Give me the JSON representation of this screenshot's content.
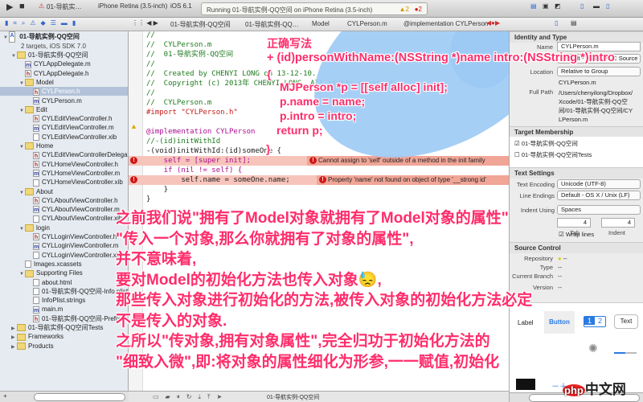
{
  "toolbar": {
    "scheme": "01-导航实…",
    "device": "iPhone Retina (3.5-inch)",
    "os": "iOS 6.1",
    "status": "Running 01-导航实例-QQ空间 on iPhone Retina (3.5-inch)",
    "warnings": "2",
    "errors": "2"
  },
  "jumpbar": [
    "01-导航实例-QQ空间",
    "01-导航实例-QQ…",
    "Model",
    "CYLPerson.m",
    "@implementation CYLPerson"
  ],
  "sidebar": {
    "project": "01-导航实例-QQ空间",
    "project_sub": "2 targets, iOS SDK 7.0",
    "items": [
      {
        "label": "01-导航实例-QQ空间",
        "type": "f",
        "lvl": 1
      },
      {
        "label": "CYLAppDelegate.m",
        "type": "m",
        "lvl": 2
      },
      {
        "label": "CYLAppDelegate.h",
        "type": "h",
        "lvl": 2
      },
      {
        "label": "Model",
        "type": "f",
        "lvl": 2
      },
      {
        "label": "CYLPerson.h",
        "type": "h",
        "lvl": 3,
        "sel": true
      },
      {
        "label": "CYLPerson.m",
        "type": "m",
        "lvl": 3
      },
      {
        "label": "Edit",
        "type": "f",
        "lvl": 2
      },
      {
        "label": "CYLEditViewController.h",
        "type": "h",
        "lvl": 3
      },
      {
        "label": "CYLEditViewController.m",
        "type": "m",
        "lvl": 3
      },
      {
        "label": "CYLEditViewController.xib",
        "type": "x",
        "lvl": 3
      },
      {
        "label": "Home",
        "type": "f",
        "lvl": 2
      },
      {
        "label": "CYLEditViewControllerDelegate.h",
        "type": "h",
        "lvl": 3
      },
      {
        "label": "CYLHomeViewController.h",
        "type": "h",
        "lvl": 3
      },
      {
        "label": "CYLHomeViewController.m",
        "type": "m",
        "lvl": 3
      },
      {
        "label": "CYLHomeViewController.xib",
        "type": "x",
        "lvl": 3
      },
      {
        "label": "About",
        "type": "f",
        "lvl": 2
      },
      {
        "label": "CYLAboutViewController.h",
        "type": "h",
        "lvl": 3
      },
      {
        "label": "CYLAboutViewController.m",
        "type": "m",
        "lvl": 3
      },
      {
        "label": "CYLAboutViewController.xib",
        "type": "x",
        "lvl": 3
      },
      {
        "label": "login",
        "type": "f",
        "lvl": 2
      },
      {
        "label": "CYLLoginViewController.h",
        "type": "h",
        "lvl": 3
      },
      {
        "label": "CYLLoginViewController.m",
        "type": "m",
        "lvl": 3
      },
      {
        "label": "CYLLoginViewController.xib",
        "type": "x",
        "lvl": 3
      },
      {
        "label": "Images.xcassets",
        "type": "a",
        "lvl": 2
      },
      {
        "label": "Supporting Files",
        "type": "f",
        "lvl": 2
      },
      {
        "label": "about.html",
        "type": "x",
        "lvl": 3
      },
      {
        "label": "01-导航实例-QQ空间-Info.plist",
        "type": "x",
        "lvl": 3
      },
      {
        "label": "InfoPlist.strings",
        "type": "x",
        "lvl": 3
      },
      {
        "label": "main.m",
        "type": "m",
        "lvl": 3
      },
      {
        "label": "01-导航实例-QQ空间-Prefix.pch",
        "type": "h",
        "lvl": 3
      },
      {
        "label": "01-导航实例-QQ空间Tests",
        "type": "f",
        "lvl": 1
      },
      {
        "label": "Frameworks",
        "type": "f",
        "lvl": 1
      },
      {
        "label": "Products",
        "type": "f",
        "lvl": 1
      }
    ]
  },
  "code": [
    {
      "t": "//",
      "c": "cm"
    },
    {
      "t": "//  CYLPerson.m",
      "c": "cm"
    },
    {
      "t": "//  01-导航实例-QQ空间",
      "c": "cm"
    },
    {
      "t": "//",
      "c": "cm"
    },
    {
      "t": "//  Created by CHENYI LONG on 13-12-10.",
      "c": "cm"
    },
    {
      "t": "//  Copyright (c) 2013年 CHENYI LONG. All rights reserved.",
      "c": "cm"
    },
    {
      "t": "//",
      "c": "cm"
    },
    {
      "t": "//  CYLPerson.m",
      "c": "cm"
    },
    {
      "t": "#import \"CYLPerson.h\"",
      "c": "st"
    },
    {
      "t": "",
      "c": "tx"
    },
    {
      "t": "@implementation CYLPerson",
      "c": "kw"
    },
    {
      "t": "//-(id)initWithId",
      "c": "cm"
    },
    {
      "t": "-(void)initWithId:(id)someOne {",
      "c": "tx"
    },
    {
      "t": "    self = [super init];",
      "c": "kw"
    },
    {
      "t": "    if (nil != self) {",
      "c": "kw"
    },
    {
      "t": "        self.name = someOne.name;",
      "c": "tx"
    },
    {
      "t": "    }",
      "c": "tx"
    },
    {
      "t": "}",
      "c": "tx"
    }
  ],
  "errors": [
    "Cannot assign to 'self' outside of a method in the init family",
    "Property 'name' not found on object of type '__strong id'"
  ],
  "annotation": {
    "title": "正确写法",
    "sig": "+ (id)personWithName:(NSString *)name intro:(NSString *)intro",
    "open": "{",
    "l1": "MJPerson *p = [[self alloc] init];",
    "l2": "p.name = name;",
    "l3": "p.intro = intro;",
    "l4": "return p;",
    "close": "}"
  },
  "overlay": [
    "之前我们说\"拥有了Model对象就拥有了Model对象的属性\"",
    "\"传入一个对象,那么你就拥有了对象的属性\",",
    "并不意味着,",
    "要对Model的初始化方法也传入对象😓,",
    "那些传入对象进行初始化的方法,被传入对象的初始化方法必定",
    "不是传入的对象.",
    "之所以\"传对象,拥有对象属性\",完全归功于初始化方法的",
    "\"细致入微\",即:将对象的属性细化为形参,一一赋值,初始化"
  ],
  "inspector": {
    "identity": "Identity and Type",
    "name_label": "Name",
    "name": "CYLPerson.m",
    "type_label": "Type",
    "type": "Default - Objective-C Source",
    "location_label": "Location",
    "location": "Relative to Group",
    "file": "CYLPerson.m",
    "fullpath_label": "Full Path",
    "fullpath": "/Users/chenyilong/Dropbox/Xcode/01-导航实例-QQ空间/01-导航实例-QQ空间/CYLPerson.m",
    "membership": "Target Membership",
    "target1": "01-导航实例-QQ空间",
    "target2": "01-导航实例-QQ空间Tests",
    "textsettings": "Text Settings",
    "enc_label": "Text Encoding",
    "enc": "Unicode (UTF-8)",
    "le_label": "Line Endings",
    "le": "Default - OS X / Unix (LF)",
    "indent_label": "Indent Using",
    "indent": "Spaces",
    "tab": "4",
    "indentw": "4",
    "tab_label": "Tab",
    "indent_w_label": "Indent",
    "wrap": "Wrap lines",
    "sc": "Source Control",
    "repo_label": "Repository",
    "repo": "--",
    "sctype_label": "Type",
    "sctype": "--",
    "branch_label": "Current Branch",
    "branch": "--",
    "version_label": "Version",
    "version": "--"
  },
  "library": {
    "label": "Label",
    "button": "Button",
    "seg1": "1",
    "seg2": "2",
    "text": "Text"
  },
  "debug": {
    "target": "01-导航实例-QQ空间"
  },
  "watermark": "php中文网"
}
